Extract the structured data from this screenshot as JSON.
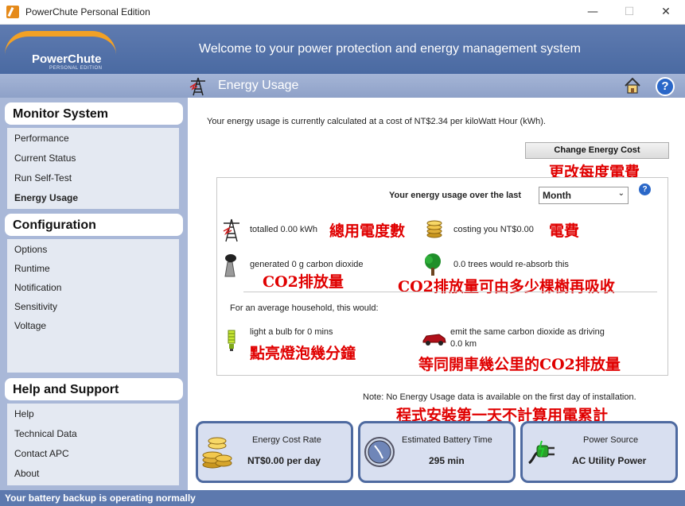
{
  "window": {
    "title": "PowerChute Personal Edition",
    "minimize": "—",
    "maximize": "☐",
    "close": "✕"
  },
  "header": {
    "logo_text": "PowerChute",
    "logo_sub": "PERSONAL EDITION",
    "welcome": "Welcome to your power protection and energy management system"
  },
  "subheader": {
    "title": "Energy Usage",
    "icons": [
      "power-tower-icon",
      "home-icon",
      "help-icon"
    ]
  },
  "sidebar": {
    "monitor": {
      "title": "Monitor System",
      "items": [
        "Performance",
        "Current Status",
        "Run Self-Test",
        "Energy Usage"
      ]
    },
    "configuration": {
      "title": "Configuration",
      "items": [
        "Options",
        "Runtime",
        "Notification",
        "Sensitivity",
        "Voltage"
      ]
    },
    "help": {
      "title": "Help and Support",
      "items": [
        "Help",
        "Technical Data",
        "Contact APC",
        "About"
      ]
    }
  },
  "main": {
    "cost_line": "Your energy usage is currently calculated at a cost of NT$2.34 per kiloWatt Hour (kWh).",
    "change_button": "Change Energy Cost",
    "over_label": "Your energy usage over the last",
    "period": "Month",
    "totalled": "totalled 0.00 kWh",
    "costing": "costing you  NT$0.00",
    "generated": "generated 0 g carbon dioxide",
    "trees": "0.0 trees would re-absorb this",
    "household": "For an average household, this would:",
    "bulb": "light a bulb for 0 mins",
    "car_line1": "emit the same carbon dioxide as driving",
    "car_line2": "0.0 km",
    "note": "Note: No Energy Usage data is available on the first day of installation."
  },
  "annotations": {
    "change_cost": "更改每度電費",
    "total_usage": "總用電度數",
    "fee": "電費",
    "co2": "CO2排放量",
    "trees": "CO2排放量可由多少棵樹再吸收",
    "bulb": "點亮燈泡幾分鐘",
    "car": "等同開車幾公里的CO2排放量",
    "first_day": "程式安裝第一天不計算用電累計"
  },
  "cards": [
    {
      "label": "Energy Cost Rate",
      "value": "NT$0.00 per day",
      "icon": "coins-icon"
    },
    {
      "label": "Estimated Battery Time",
      "value": "295 min",
      "icon": "clock-icon"
    },
    {
      "label": "Power Source",
      "value": "AC Utility Power",
      "icon": "power-plug-icon"
    }
  ],
  "status": "Your battery backup is operating normally",
  "colors": {
    "banner": "#4a6aa2",
    "sidebar": "#a9b8d8",
    "annotation": "#e00000",
    "accent": "#f3a125"
  }
}
